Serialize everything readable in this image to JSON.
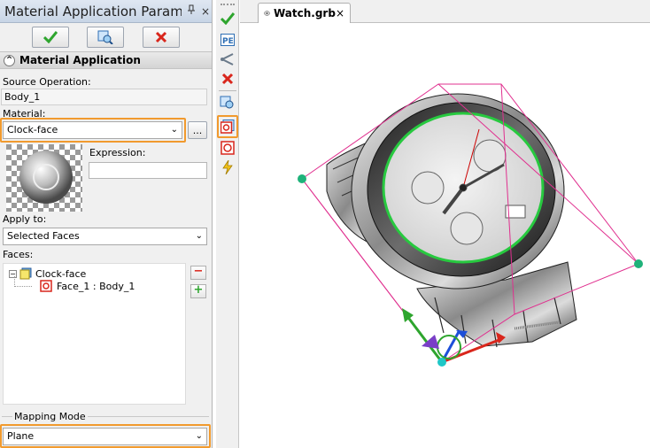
{
  "panel": {
    "title": "Material Application Parame...",
    "pin_icon": "pin-icon",
    "close_glyph": "×",
    "section_title": "Material Application",
    "source_label": "Source Operation:",
    "source_value": "Body_1",
    "material_label": "Material:",
    "material_value": "Clock-face",
    "browse_label": "...",
    "expression_label": "Expression:",
    "expression_value": "",
    "apply_label": "Apply to:",
    "apply_value": "Selected Faces",
    "faces_label": "Faces:",
    "tree": {
      "root": "Clock-face",
      "child": "Face_1 : Body_1"
    },
    "remove_label": "−",
    "add_label": "+",
    "mapping_legend": "Mapping Mode",
    "mapping_value": "Plane"
  },
  "tab": {
    "label": "Watch.grb",
    "close_glyph": "×"
  },
  "colors": {
    "highlight": "#f19a2e",
    "accept": "#2ea52e",
    "cancel": "#d9261c",
    "frame": "#e0308f",
    "handle": "#1fb27a"
  }
}
